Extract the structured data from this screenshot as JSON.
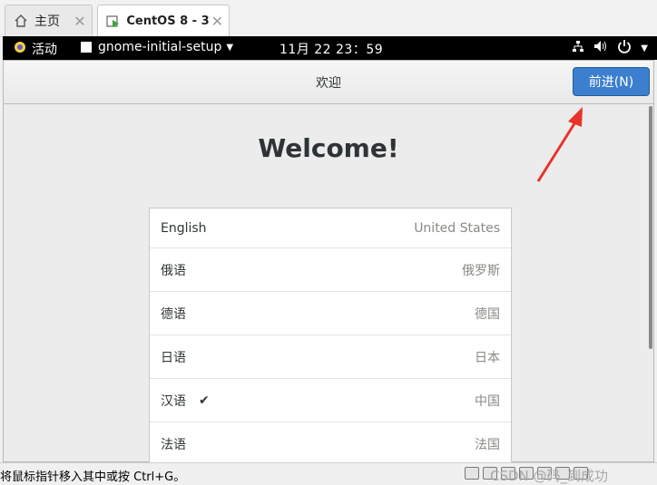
{
  "tabs": [
    {
      "label": "主页",
      "icon": "home-icon",
      "active": false
    },
    {
      "label": "CentOS 8 - 3",
      "icon": "vm-running-icon",
      "active": true
    }
  ],
  "topbar": {
    "activities": "活动",
    "app_name": "gnome-initial-setup",
    "clock": "11月 22  23：59"
  },
  "window": {
    "title": "欢迎",
    "next_button": "前进(N)",
    "welcome": "Welcome!"
  },
  "languages": [
    {
      "name": "English",
      "region": "United States",
      "selected": false
    },
    {
      "name": "俄语",
      "region": "俄罗斯",
      "selected": false
    },
    {
      "name": "德语",
      "region": "德国",
      "selected": false
    },
    {
      "name": "日语",
      "region": "日本",
      "selected": false
    },
    {
      "name": "汉语",
      "region": "中国",
      "selected": true,
      "check": "✔"
    },
    {
      "name": "法语",
      "region": "法国",
      "selected": false
    }
  ],
  "status": {
    "message": "将鼠标指针移入其中或按 Ctrl+G。",
    "watermark": "CSDN @码_到成功"
  },
  "colors": {
    "accent": "#3b7fce",
    "annotation_arrow": "#e8332b"
  }
}
